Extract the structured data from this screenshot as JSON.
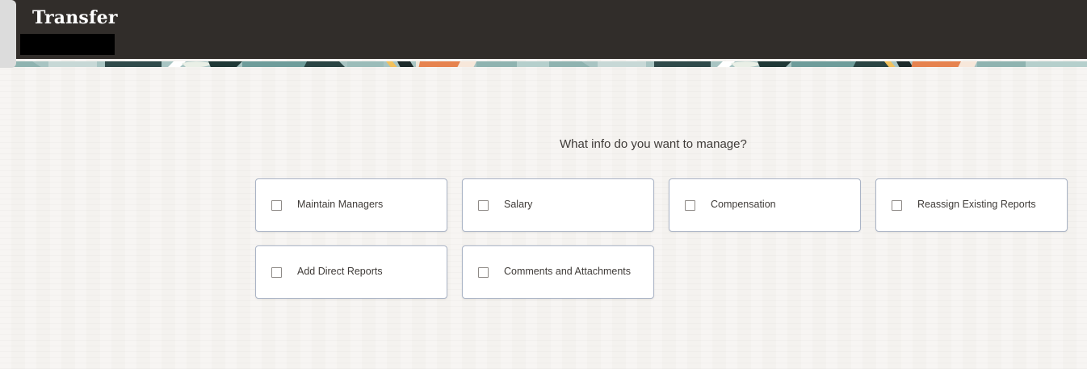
{
  "header": {
    "title": "Transfer",
    "background_color": "#312d2a"
  },
  "question": "What info do you want to manage?",
  "options": [
    {
      "label": "Maintain Managers",
      "checked": false
    },
    {
      "label": "Salary",
      "checked": false
    },
    {
      "label": "Compensation",
      "checked": false
    },
    {
      "label": "Reassign Existing Reports",
      "checked": false
    },
    {
      "label": "Add Direct Reports",
      "checked": false
    },
    {
      "label": "Comments and Attachments",
      "checked": false
    }
  ],
  "colors": {
    "page_background": "#f4f2ef",
    "card_border": "#aab4c6",
    "text": "#3f3b38"
  }
}
